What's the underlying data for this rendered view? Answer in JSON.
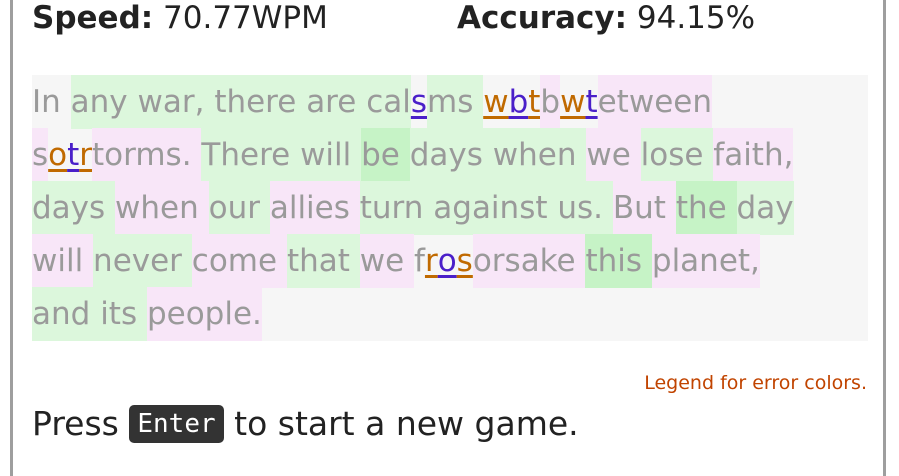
{
  "stats": {
    "speed_label": "Speed:",
    "speed_value": "70.77WPM",
    "accuracy_label": "Accuracy:",
    "accuracy_value": "94.15%"
  },
  "typing_text": {
    "lines": [
      [
        {
          "t": "In ",
          "s": ""
        },
        {
          "t": "any ",
          "s": "g"
        },
        {
          "t": "war, ",
          "s": "g"
        },
        {
          "t": "there ",
          "s": "g"
        },
        {
          "t": "are ",
          "s": "g"
        },
        {
          "t": "cal",
          "s": "g"
        },
        {
          "t": "s",
          "s": "e-purple"
        },
        {
          "t": "ms ",
          "s": "g"
        },
        {
          "t": "w",
          "s": "e-orange"
        },
        {
          "t": "b",
          "s": "e-purple"
        },
        {
          "t": "t",
          "s": "e-orange"
        },
        {
          "t": "b",
          "s": "p"
        },
        {
          "t": "w",
          "s": "e-orange"
        },
        {
          "t": "t",
          "s": "e-purple"
        },
        {
          "t": "etween",
          "s": "p"
        }
      ],
      [
        {
          "t": "s",
          "s": "p"
        },
        {
          "t": "o",
          "s": "e-orange"
        },
        {
          "t": "t",
          "s": "e-purple"
        },
        {
          "t": "r",
          "s": "e-orange"
        },
        {
          "t": "torms. ",
          "s": "p"
        },
        {
          "t": "There ",
          "s": "g"
        },
        {
          "t": "will ",
          "s": "g"
        },
        {
          "t": "be ",
          "s": "g2"
        },
        {
          "t": "days ",
          "s": "g"
        },
        {
          "t": "when ",
          "s": "g"
        },
        {
          "t": "we ",
          "s": "p"
        },
        {
          "t": "lose ",
          "s": "g"
        },
        {
          "t": "faith,",
          "s": "p"
        }
      ],
      [
        {
          "t": "days ",
          "s": "g"
        },
        {
          "t": "when ",
          "s": "p"
        },
        {
          "t": "our ",
          "s": "g"
        },
        {
          "t": "allies ",
          "s": "p"
        },
        {
          "t": "turn ",
          "s": "g"
        },
        {
          "t": "against ",
          "s": "g"
        },
        {
          "t": "us. ",
          "s": "g"
        },
        {
          "t": "But ",
          "s": "p"
        },
        {
          "t": "the ",
          "s": "g2"
        },
        {
          "t": "day",
          "s": "g"
        }
      ],
      [
        {
          "t": "will ",
          "s": "p"
        },
        {
          "t": "never ",
          "s": "g"
        },
        {
          "t": "come ",
          "s": "p"
        },
        {
          "t": "that ",
          "s": "g"
        },
        {
          "t": "we ",
          "s": "p"
        },
        {
          "t": "f",
          "s": ""
        },
        {
          "t": "r",
          "s": "e-orange"
        },
        {
          "t": "o",
          "s": "e-purple"
        },
        {
          "t": "s",
          "s": "e-orange"
        },
        {
          "t": "orsake ",
          "s": "p"
        },
        {
          "t": "this ",
          "s": "g2"
        },
        {
          "t": "planet,",
          "s": "p"
        }
      ],
      [
        {
          "t": "and ",
          "s": "g"
        },
        {
          "t": "its ",
          "s": "g"
        },
        {
          "t": "people.",
          "s": "p"
        }
      ]
    ]
  },
  "legend_link": "Legend for error colors.",
  "prompt": {
    "before": "Press",
    "key": "Enter",
    "after": "to start a new game."
  },
  "colors": {
    "correct_bg": "#dcf7dc",
    "slow_bg": "#f8e6f8",
    "error_orange": "#c06a00",
    "error_purple": "#4a1fc9",
    "legend": "#c14400"
  }
}
